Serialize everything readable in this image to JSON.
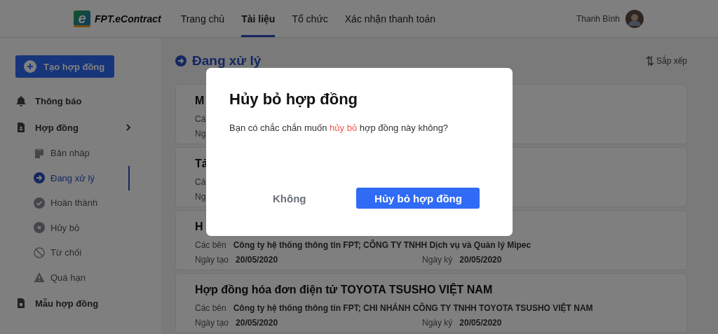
{
  "header": {
    "logo_mark": "e",
    "logo_text": "FPT.eContract",
    "nav": [
      {
        "label": "Trang chủ",
        "selected": false
      },
      {
        "label": "Tài liệu",
        "selected": true
      },
      {
        "label": "Tổ chức",
        "selected": false
      },
      {
        "label": "Xác nhận thanh toán",
        "selected": false
      }
    ],
    "user_name": "Thanh Bình"
  },
  "sidebar": {
    "create_button": "Tạo hợp đồng",
    "items": [
      {
        "label": "Thông báo"
      },
      {
        "label": "Hợp đồng",
        "children": [
          {
            "label": "Bản nháp",
            "selected": false
          },
          {
            "label": "Đang xử lý",
            "selected": true
          },
          {
            "label": "Hoàn thành",
            "selected": false
          },
          {
            "label": "Hủy bỏ",
            "selected": false
          },
          {
            "label": "Từ chối",
            "selected": false
          },
          {
            "label": "Quá hạn",
            "selected": false
          }
        ]
      },
      {
        "label": "Mẫu hợp đồng"
      }
    ]
  },
  "main": {
    "title": "Đang xử lý",
    "sort_label": "Sắp xếp",
    "cards": [
      {
        "title": "M",
        "parties_label": "Cá",
        "created_label": "Ng"
      },
      {
        "title": "Tả",
        "parties_label": "Cá",
        "created_label": "Ng"
      },
      {
        "title": "H",
        "parties_label": "Các bên",
        "parties": "Công ty hệ thống thông tin FPT; CÔNG TY TNHH Dịch vụ và Quản lý Mipec",
        "created_label": "Ngày tạo",
        "created": "20/05/2020",
        "signed_label": "Ngày ký",
        "signed": "20/05/2020"
      },
      {
        "title": "Hợp đồng hóa đơn điện tử TOYOTA TSUSHO VIỆT NAM",
        "parties_label": "Các bên",
        "parties": "Công ty hệ thống thông tin FPT; CHI NHÁNH CÔNG TY TNHH TOYOTA TSUSHO VIỆT NAM",
        "created_label": "Ngày tạo",
        "created": "20/05/2020",
        "signed_label": "Ngày ký",
        "signed": "20/05/2020"
      }
    ]
  },
  "modal": {
    "title": "Hủy bỏ hợp đồng",
    "message_before": "Bạn có chắc chắn muốn ",
    "message_highlight": "hủy bỏ",
    "message_after": " hợp đồng này không?",
    "cancel_button": "Không",
    "confirm_button": "Hủy bỏ hợp đồng"
  }
}
